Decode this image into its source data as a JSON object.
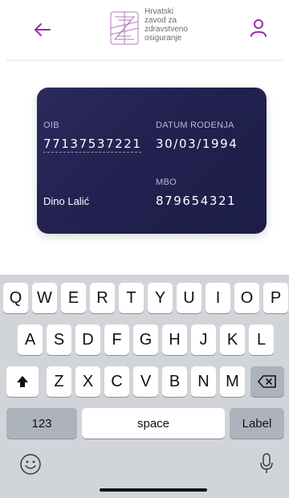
{
  "header": {
    "logo_lines": [
      "Hrvatski",
      "zavod za",
      "zdravstveno",
      "osiguranje"
    ],
    "colors": {
      "accent": "#9b2bb0"
    },
    "icons": {
      "back": "arrow-left-icon",
      "profile": "user-icon",
      "logo": "hzzo-logo"
    }
  },
  "card": {
    "oib_label": "OIB",
    "oib_value": "77137537221",
    "dob_label": "DATUM RODENJA",
    "dob_value": "30/03/1994",
    "mbo_label": "MBO",
    "mbo_value": "879654321",
    "holder_name": "Dino Lalić",
    "colors": {
      "background": "#24234f"
    }
  },
  "keyboard": {
    "row1": [
      "Q",
      "W",
      "E",
      "R",
      "T",
      "Y",
      "U",
      "I",
      "O",
      "P"
    ],
    "row2": [
      "A",
      "S",
      "D",
      "F",
      "G",
      "H",
      "J",
      "K",
      "L"
    ],
    "row3": [
      "Z",
      "X",
      "C",
      "V",
      "B",
      "N",
      "M"
    ],
    "numbers_key": "123",
    "space_key": "space",
    "return_key": "Label",
    "icons": {
      "shift": "shift-icon",
      "backspace": "backspace-icon",
      "emoji": "emoji-icon",
      "mic": "microphone-icon"
    }
  }
}
